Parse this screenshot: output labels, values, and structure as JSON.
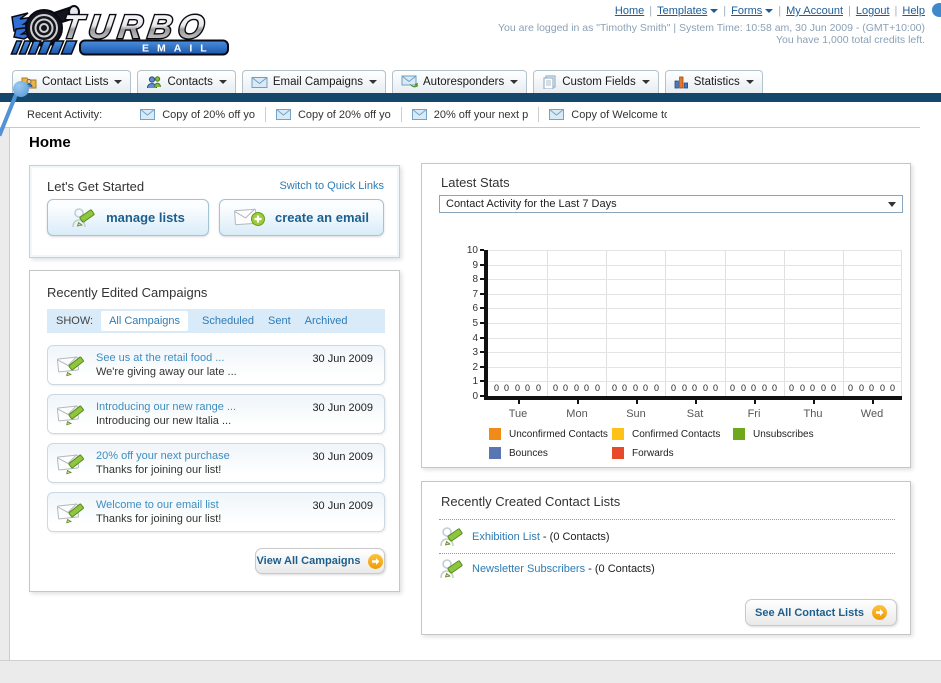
{
  "header": {
    "top_links": [
      "Home",
      "Templates",
      "Forms",
      "My Account",
      "Logout",
      "Help"
    ],
    "login_info": "You are logged in as \"Timothy Smith\" | System Time: 10:58 am, 30 Jun 2009 - (GMT+10:00)",
    "credits_info": "You have 1,000 total credits left.",
    "logo_title": "TURBO",
    "logo_subtitle": "EMAIL"
  },
  "nav": {
    "tabs": [
      {
        "label": "Contact Lists"
      },
      {
        "label": "Contacts"
      },
      {
        "label": "Email Campaigns"
      },
      {
        "label": "Autoresponders"
      },
      {
        "label": "Custom Fields"
      },
      {
        "label": "Statistics"
      }
    ]
  },
  "recent_activity": {
    "label": "Recent Activity:",
    "items": [
      "Copy of 20% off yo",
      "Copy of 20% off yo",
      "20% off your next p",
      "Copy of Welcome to"
    ]
  },
  "page_title": "Home",
  "get_started": {
    "title": "Let's Get Started",
    "switch_link": "Switch to Quick Links",
    "manage_button": "manage lists",
    "create_button": "create an email"
  },
  "campaigns": {
    "title": "Recently Edited Campaigns",
    "show_label": "SHOW:",
    "filters": [
      "All Campaigns",
      "Scheduled",
      "Sent",
      "Archived"
    ],
    "active_filter": "All Campaigns",
    "items": [
      {
        "title": "See us at the retail food ...",
        "subtitle": "We're giving away our late ...",
        "date": "30 Jun 2009"
      },
      {
        "title": "Introducing our new range ...",
        "subtitle": "Introducing our new Italia ...",
        "date": "30 Jun 2009"
      },
      {
        "title": "20% off your next purchase",
        "subtitle": "Thanks for joining our list!",
        "date": "30 Jun 2009"
      },
      {
        "title": "Welcome to our email list",
        "subtitle": "Thanks for joining our list!",
        "date": "30 Jun 2009"
      }
    ],
    "view_all": "View All Campaigns"
  },
  "stats": {
    "title": "Latest Stats",
    "dropdown_value": "Contact Activity for the Last 7 Days",
    "legend": [
      {
        "label": "Unconfirmed Contacts",
        "color": "#f08a18"
      },
      {
        "label": "Confirmed Contacts",
        "color": "#fdc118"
      },
      {
        "label": "Unsubscribes",
        "color": "#6fa81c"
      },
      {
        "label": "Bounces",
        "color": "#5a76b2"
      },
      {
        "label": "Forwards",
        "color": "#e64a2b"
      }
    ]
  },
  "chart_data": {
    "type": "bar",
    "title": "Contact Activity for the Last 7 Days",
    "categories": [
      "Tue",
      "Mon",
      "Sun",
      "Sat",
      "Fri",
      "Thu",
      "Wed"
    ],
    "series": [
      {
        "name": "Unconfirmed Contacts",
        "values": [
          0,
          0,
          0,
          0,
          0,
          0,
          0
        ]
      },
      {
        "name": "Confirmed Contacts",
        "values": [
          0,
          0,
          0,
          0,
          0,
          0,
          0
        ]
      },
      {
        "name": "Unsubscribes",
        "values": [
          0,
          0,
          0,
          0,
          0,
          0,
          0
        ]
      },
      {
        "name": "Bounces",
        "values": [
          0,
          0,
          0,
          0,
          0,
          0,
          0
        ]
      },
      {
        "name": "Forwards",
        "values": [
          0,
          0,
          0,
          0,
          0,
          0,
          0
        ]
      }
    ],
    "ylim": [
      0,
      10
    ],
    "grid": true,
    "legend_position": "bottom"
  },
  "contact_lists": {
    "title": "Recently Created Contact Lists",
    "items": [
      {
        "name": "Exhibition List",
        "suffix": " - (0 Contacts)"
      },
      {
        "name": "Newsletter Subscribers",
        "suffix": " - (0 Contacts)"
      }
    ],
    "see_all": "See All Contact Lists"
  }
}
